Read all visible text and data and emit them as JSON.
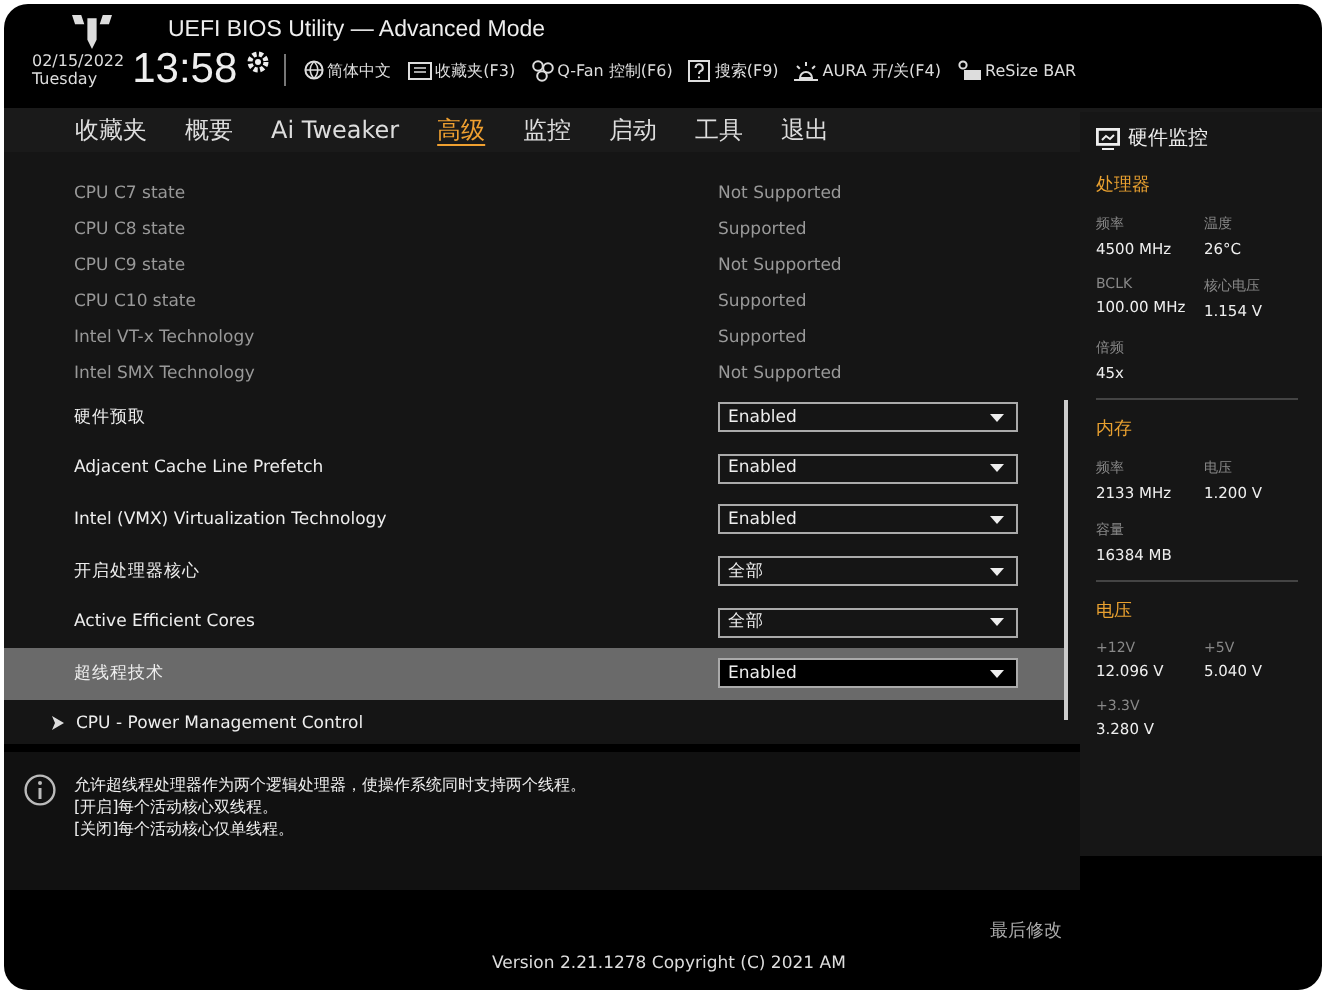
{
  "header": {
    "title": "UEFI BIOS Utility — Advanced Mode",
    "date": "02/15/2022",
    "day": "Tuesday",
    "time": "13:58",
    "toolbar": [
      {
        "kind": "globe",
        "label": "简体中文"
      },
      {
        "kind": "folder",
        "label": "收藏夹(F3)"
      },
      {
        "kind": "fan",
        "label": "Q-Fan 控制(F6)"
      },
      {
        "kind": "help",
        "label": "搜索(F9)"
      },
      {
        "kind": "aura",
        "label": "AURA 开/关(F4)"
      },
      {
        "kind": "bar",
        "label": "ReSize BAR"
      }
    ]
  },
  "tabs": [
    {
      "label": "收藏夹",
      "selected": false
    },
    {
      "label": "概要",
      "selected": false
    },
    {
      "label": "Ai Tweaker",
      "selected": false
    },
    {
      "label": "高级",
      "selected": true
    },
    {
      "label": "监控",
      "selected": false
    },
    {
      "label": "启动",
      "selected": false
    },
    {
      "label": "工具",
      "selected": false
    },
    {
      "label": "退出",
      "selected": false
    }
  ],
  "items": [
    {
      "kind": "info",
      "label": "CPU C7 state",
      "value": "Not Supported"
    },
    {
      "kind": "info",
      "label": "CPU C8 state",
      "value": "Supported"
    },
    {
      "kind": "info",
      "label": "CPU C9 state",
      "value": "Not Supported"
    },
    {
      "kind": "info",
      "label": "CPU C10 state",
      "value": "Supported"
    },
    {
      "kind": "info",
      "label": "Intel VT-x Technology",
      "value": "Supported"
    },
    {
      "kind": "info",
      "label": "Intel SMX Technology",
      "value": "Not Supported"
    },
    {
      "kind": "select",
      "label": "硬件预取",
      "value": "Enabled",
      "selected": false
    },
    {
      "kind": "select",
      "label": "Adjacent Cache Line Prefetch",
      "value": "Enabled",
      "selected": false
    },
    {
      "kind": "select",
      "label": "Intel (VMX) Virtualization Technology",
      "value": "Enabled",
      "selected": false
    },
    {
      "kind": "select",
      "label": "开启处理器核心",
      "value": "全部",
      "selected": false
    },
    {
      "kind": "select",
      "label": "Active Efficient Cores",
      "value": "全部",
      "selected": false
    },
    {
      "kind": "select",
      "label": "超线程技术",
      "value": "Enabled",
      "selected": true
    },
    {
      "kind": "submenu",
      "label": "CPU - Power Management Control",
      "selected": false
    }
  ],
  "help": [
    "允许超线程处理器作为两个逻辑处理器，使操作系统同时支持两个线程。",
    "[开启]每个活动核心双线程。",
    "[关闭]每个活动核心仅单线程。"
  ],
  "monitor": {
    "title": "硬件监控",
    "sections": [
      {
        "title": "处理器",
        "fields": [
          {
            "label": "频率",
            "value": "4500 MHz"
          },
          {
            "label": "温度",
            "value": "26°C"
          },
          {
            "label": "BCLK",
            "value": "100.00 MHz"
          },
          {
            "label": "核心电压",
            "value": "1.154 V"
          },
          {
            "label": "倍频",
            "value": "45x"
          }
        ]
      },
      {
        "title": "内存",
        "fields": [
          {
            "label": "频率",
            "value": "2133 MHz"
          },
          {
            "label": "电压",
            "value": "1.200 V"
          },
          {
            "label": "容量",
            "value": "16384 MB"
          }
        ]
      },
      {
        "title": "电压",
        "fields": [
          {
            "label": "+12V",
            "value": "12.096 V"
          },
          {
            "label": "+5V",
            "value": "5.040 V"
          },
          {
            "label": "+3.3V",
            "value": "3.280 V"
          }
        ]
      }
    ]
  },
  "footer": {
    "last_modified": "最后修改",
    "version": "Version 2.21.1278 Copyright (C) 2021 AM"
  }
}
